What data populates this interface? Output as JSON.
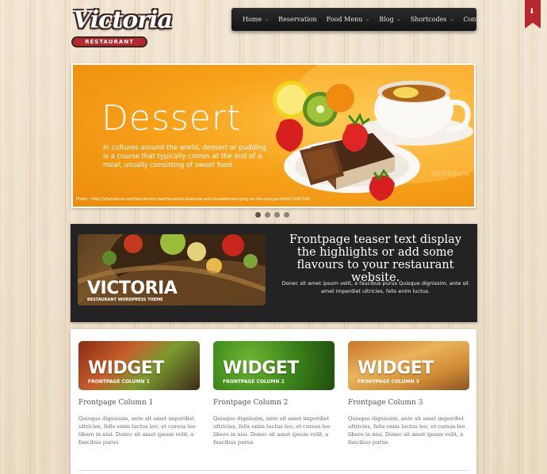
{
  "logo": {
    "name": "Victoria",
    "tagline": "RESTAURANT"
  },
  "nav": {
    "items": [
      {
        "label": "Home",
        "dropdown": true
      },
      {
        "label": "Reservation",
        "dropdown": false
      },
      {
        "label": "Food Menu",
        "dropdown": true
      },
      {
        "label": "Blog",
        "dropdown": true
      },
      {
        "label": "Shortcodes",
        "dropdown": true
      },
      {
        "label": "Contact Us",
        "dropdown": false
      }
    ]
  },
  "slider": {
    "title": "Dessert",
    "text": "In cultures around the world, dessert or pudding is a course that typically comes at the end of a meal, usually consisting of sweet food.",
    "credit": "Photo : http://photodune.net/item/lemon-teachocolate-kavicake-and-strawberries-lying-on-the-orange-fabric/1067390",
    "dots": 4,
    "active_dot": 0
  },
  "teaser": {
    "image_name": "VICTORIA",
    "image_sub": "RESTAURANT WORDPRESS THEME",
    "heading": "Frontpage teaser text display the highlights or add some flavours to your restaurant website.",
    "text": "Donec sit amet ipsum velit, a faucibus purus Quisque dignissim, ante sit amet imperdiet ultricies, felis enim luctus."
  },
  "columns": [
    {
      "widget_label": "WIDGET",
      "widget_sub": "FRONTPAGE COLUMN 1",
      "title": "Frontpage Column 1",
      "text": "Quisque dignissim, ante sit amet imperdiet ultricies, felis enim luctus leo, et cursus leo libero in nisi. Donec sit amet ipsum velit, a faucibus purus"
    },
    {
      "widget_label": "WIDGET",
      "widget_sub": "FRONTPAGE COLUMN 2",
      "title": "Frontpage Column 2",
      "text": "Quisque dignissim, ante sit amet imperdiet ultricies, felis enim luctus leo, et cursus leo libero in nisi. Donec sit amet ipsum velit, a faucibus purus"
    },
    {
      "widget_label": "WIDGET",
      "widget_sub": "FRONTPAGE COLUMN 3",
      "title": "Frontpage Column 3",
      "text": "Quisque dignissim, ante sit amet imperdiet ultricies, felis enim luctus leo, et cursus leo libero in nisi. Donec sit amet ipsum velit, a faucibus purus"
    }
  ],
  "colors": {
    "accent_red": "#b6282c",
    "nav_bg": "#1c1c1c",
    "slide_orange": "#f7a21b",
    "teaser_bg": "#232323"
  },
  "icons": {
    "bookmark": "bookmark-icon",
    "chevron": "chevron-down-icon"
  }
}
